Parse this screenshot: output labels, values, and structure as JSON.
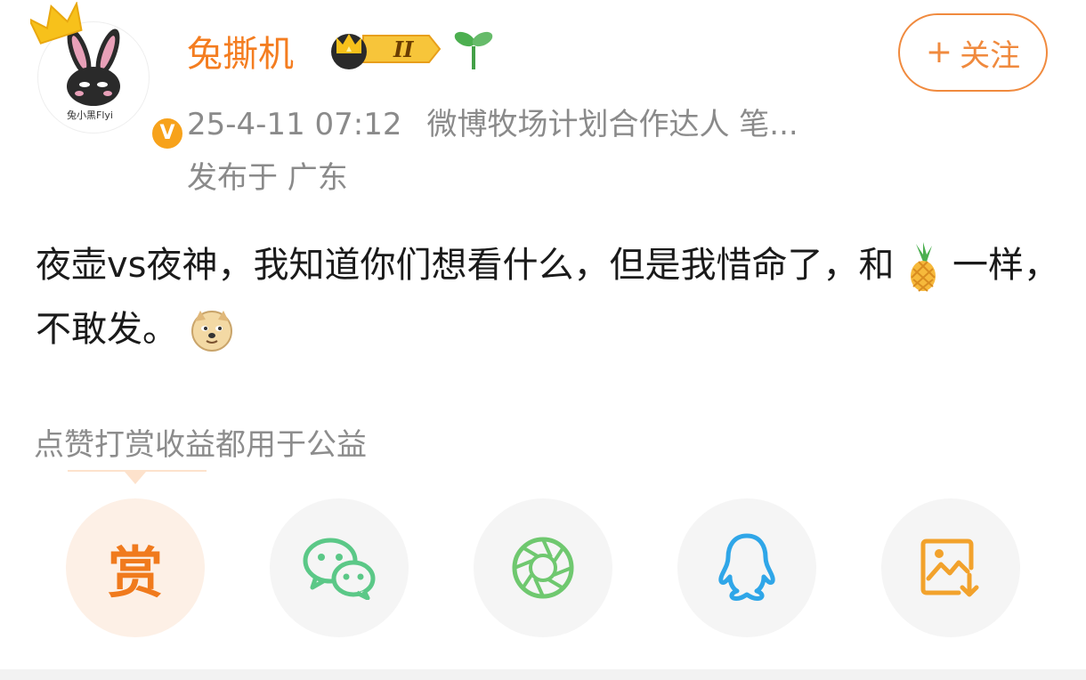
{
  "author": {
    "name": "兔撕机",
    "vip_level": "II",
    "avatar_caption": "兔小黑Flyi",
    "verified_mark": "V"
  },
  "follow_button": {
    "plus": "+",
    "label": "关注"
  },
  "post_meta": {
    "time": "25-4-11 07:12",
    "source": "微博牧场计划合作达人 笔...",
    "location": "发布于 广东"
  },
  "post": {
    "text_part1": "夜壶vs夜神，我知道你们想看什么，但是我惜命了，和",
    "text_part2": "一样，不敢发。",
    "emoji_1": "pineapple-emoji",
    "emoji_2": "doge-emoji"
  },
  "donate_note": "点赞打赏收益都用于公益",
  "share_actions": [
    {
      "label": "赏",
      "icon": "reward-icon",
      "color": "#f07a1d"
    },
    {
      "icon": "wechat-icon",
      "color": "#5bc887"
    },
    {
      "icon": "moments-icon",
      "color": "#6fc86f"
    },
    {
      "icon": "qq-icon",
      "color": "#2fa6e8"
    },
    {
      "icon": "save-image-icon",
      "color": "#f2a22c"
    }
  ],
  "colors": {
    "accent": "#f47d20",
    "meta": "#8a8a8a",
    "text": "#1a1a1a"
  }
}
